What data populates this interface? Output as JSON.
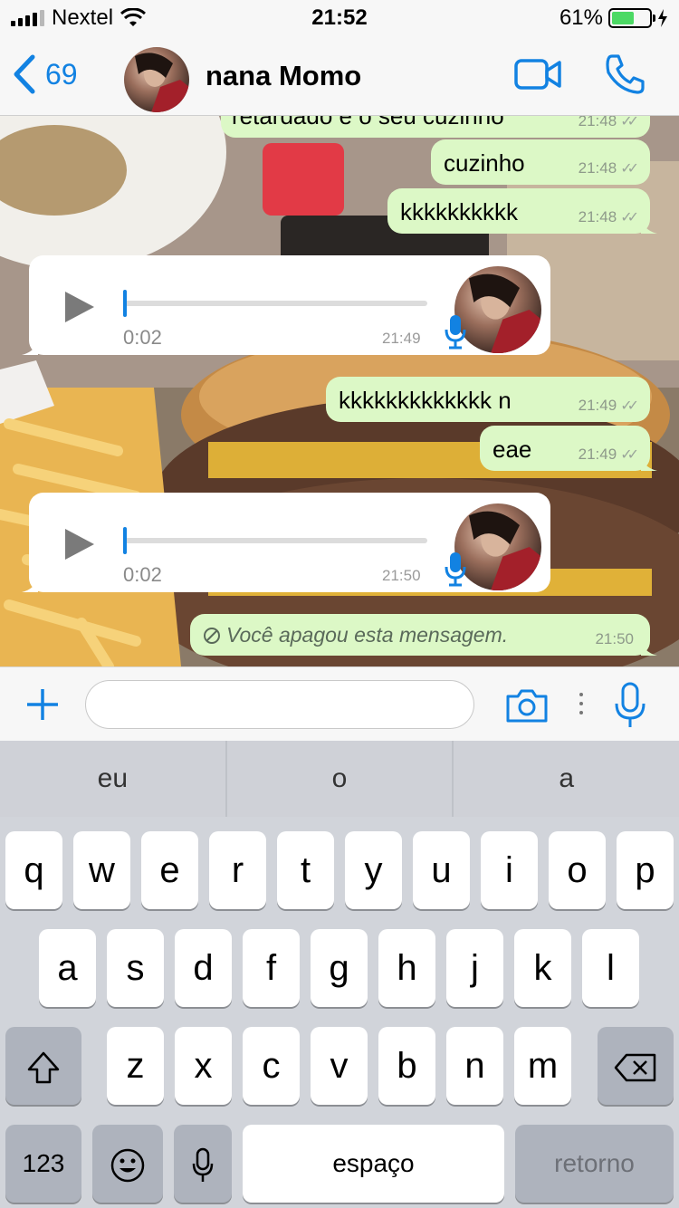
{
  "status_bar": {
    "carrier": "Nextel",
    "time": "21:52",
    "battery_percent": "61%",
    "battery_level": 0.61
  },
  "header": {
    "back_count": "69",
    "contact_name": "nana Momo"
  },
  "colors": {
    "accent": "#1282e2",
    "outgoing_bubble": "#dcf8c6",
    "incoming_bubble": "#ffffff"
  },
  "messages": [
    {
      "type": "text",
      "direction": "out",
      "text": "retardado e o seu cuzinho",
      "time": "21:48"
    },
    {
      "type": "text",
      "direction": "out",
      "text": "cuzinho",
      "time": "21:48"
    },
    {
      "type": "text",
      "direction": "out",
      "text": "kkkkkkkkkk",
      "time": "21:48"
    },
    {
      "type": "voice",
      "direction": "in",
      "duration": "0:02",
      "time": "21:49"
    },
    {
      "type": "text",
      "direction": "out",
      "text": "kkkkkkkkkkkkk n",
      "time": "21:49"
    },
    {
      "type": "text",
      "direction": "out",
      "text": "eae",
      "time": "21:49"
    },
    {
      "type": "voice",
      "direction": "in",
      "duration": "0:02",
      "time": "21:50"
    },
    {
      "type": "deleted",
      "direction": "out",
      "text": "Você apagou esta mensagem.",
      "time": "21:50"
    }
  ],
  "input": {
    "placeholder": ""
  },
  "keyboard": {
    "suggestions": [
      "eu",
      "o",
      "a"
    ],
    "row1": [
      "q",
      "w",
      "e",
      "r",
      "t",
      "y",
      "u",
      "i",
      "o",
      "p"
    ],
    "row2": [
      "a",
      "s",
      "d",
      "f",
      "g",
      "h",
      "j",
      "k",
      "l"
    ],
    "row3": [
      "z",
      "x",
      "c",
      "v",
      "b",
      "n",
      "m"
    ],
    "numbers_label": "123",
    "space_label": "espaço",
    "return_label": "retorno"
  }
}
